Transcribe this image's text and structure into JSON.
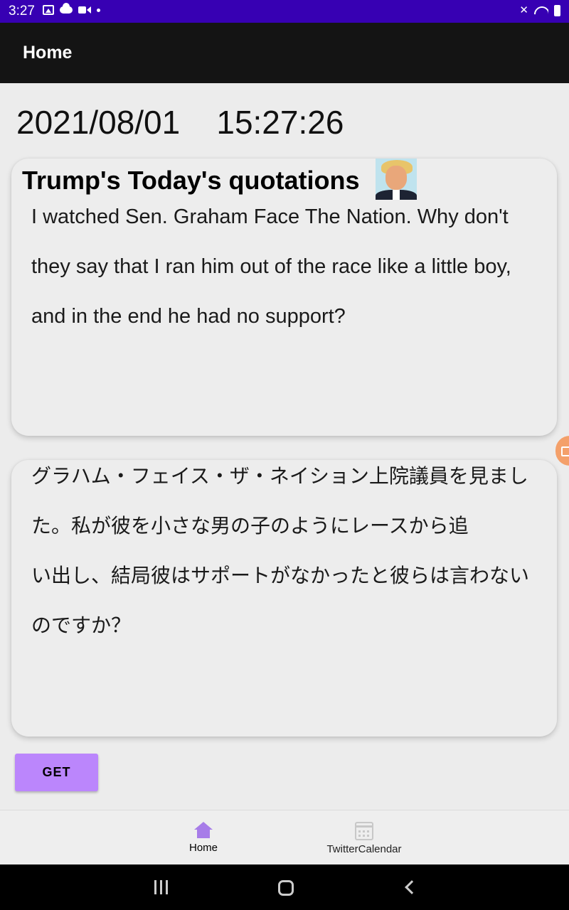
{
  "status_bar": {
    "time": "3:27",
    "icons_left": [
      "image-icon",
      "cloud-icon",
      "video-icon",
      "dot-icon"
    ],
    "icons_right": [
      "mute-icon",
      "wifi-icon",
      "battery-icon"
    ]
  },
  "app_bar": {
    "title": "Home"
  },
  "datetime": {
    "date": "2021/08/01",
    "time": "15:27:26"
  },
  "english_card": {
    "title": "Trump's Today's quotations",
    "quote": "I watched Sen. Graham Face The Nation. Why don't they say that I ran him out of the race like a little boy, and in the end he had no support?"
  },
  "japanese_card": {
    "quote": "グラハム・フェイス・ザ・ネイション上院議員を見ました。私が彼を小さな男の子のようにレースから追\nい出し、結局彼はサポートがなかったと彼らは言わないのですか？"
  },
  "get_button": {
    "label": "GET"
  },
  "bottom_nav": {
    "items": [
      {
        "label": "Home",
        "icon": "home-icon",
        "active": true
      },
      {
        "label": "TwitterCalendar",
        "icon": "calendar-icon",
        "active": false
      }
    ]
  },
  "colors": {
    "status_bar": "#3700b3",
    "app_bar": "#141414",
    "button": "#bb86fc",
    "active_nav": "#a77ce8"
  }
}
